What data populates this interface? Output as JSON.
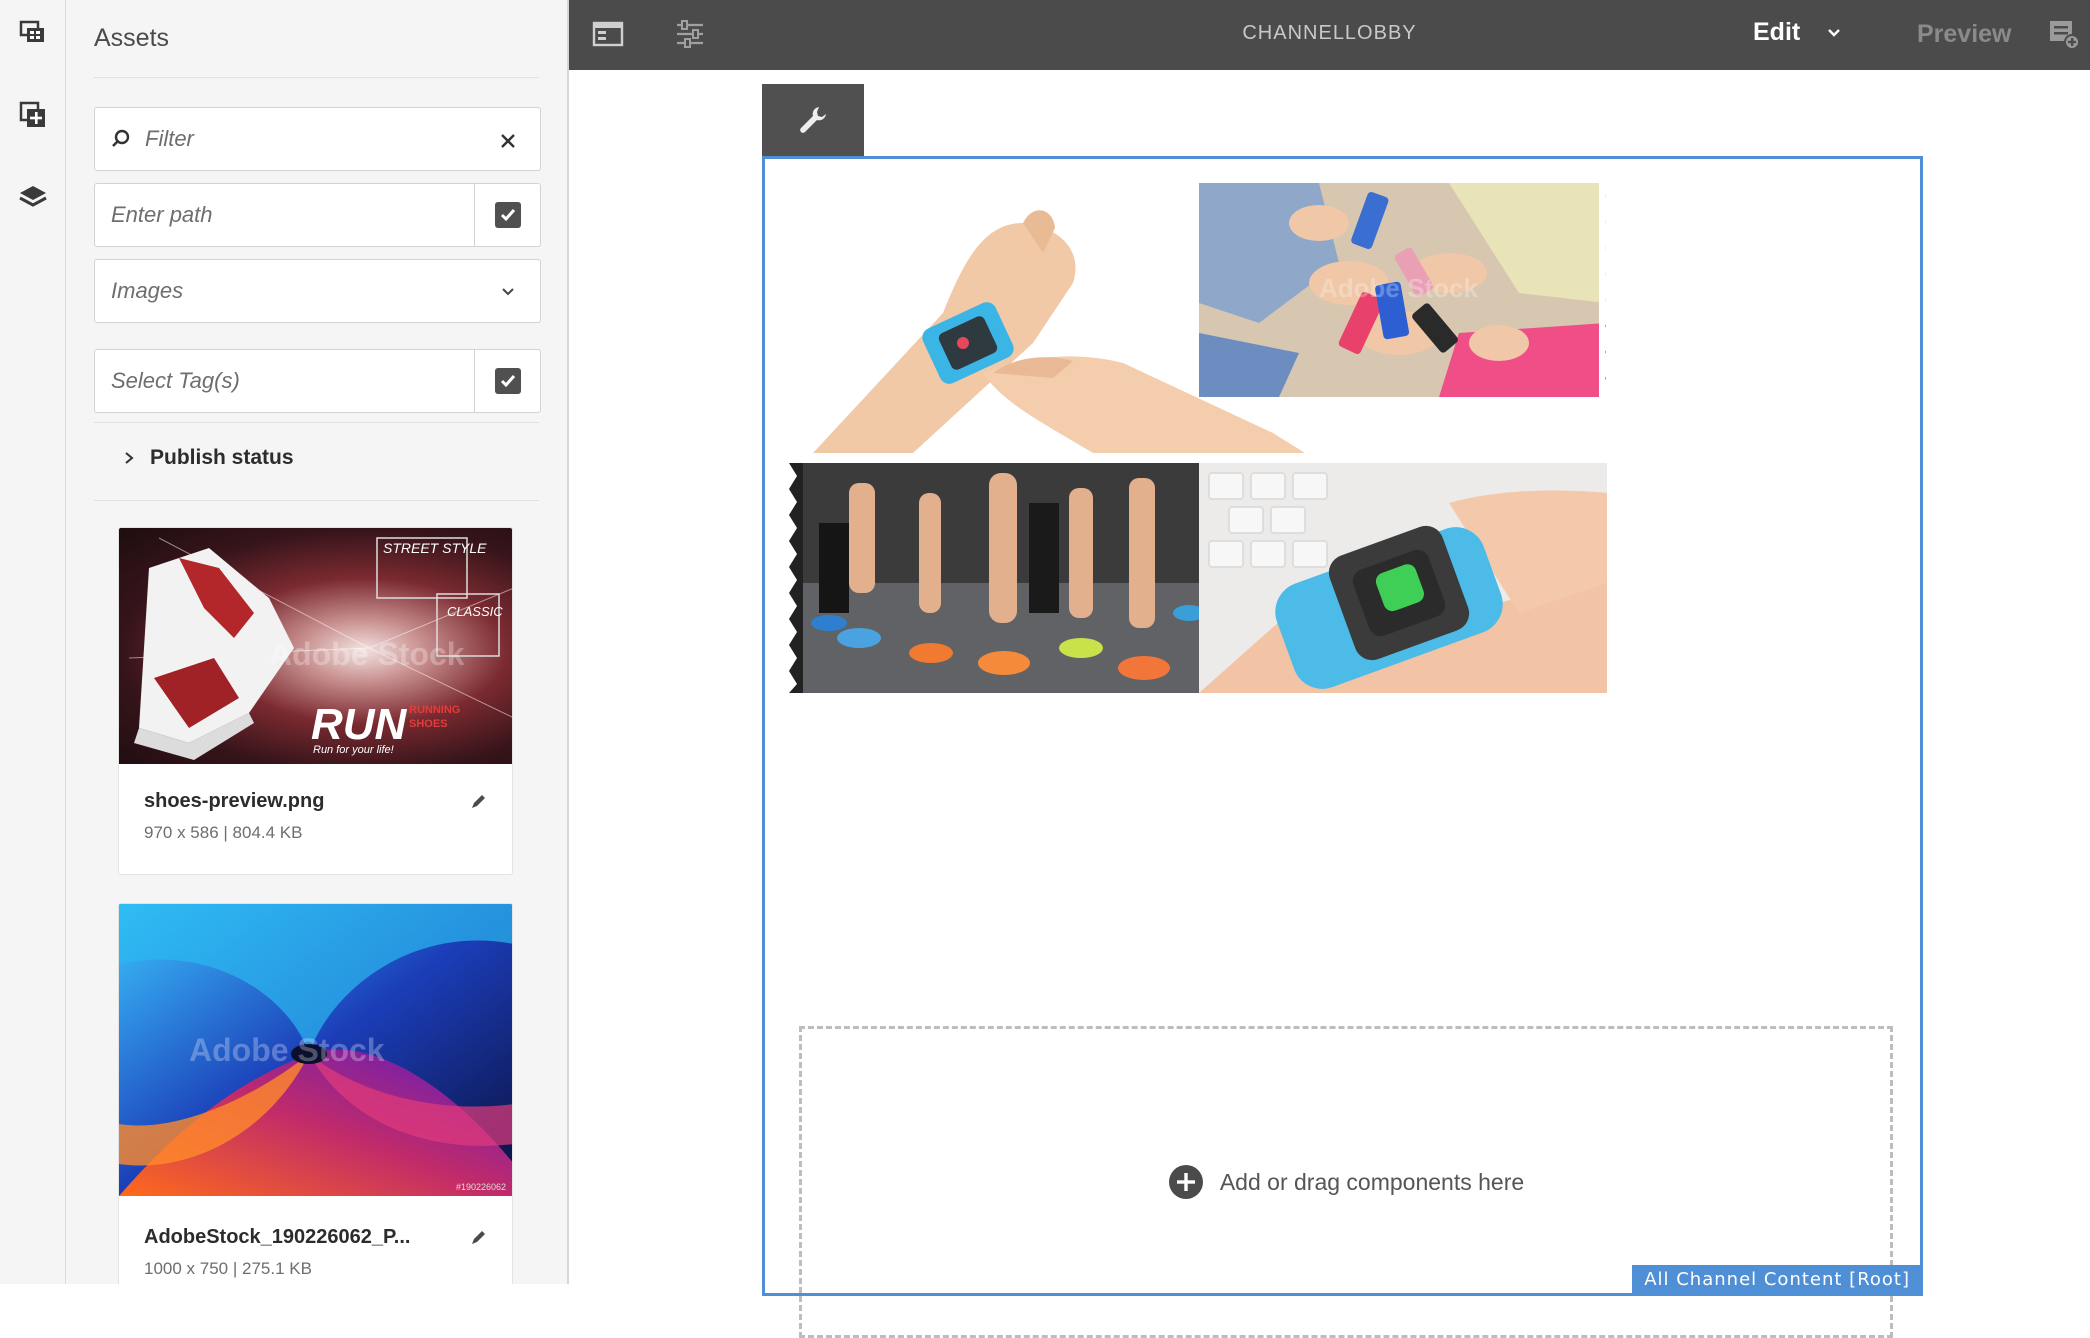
{
  "rail": {
    "icons": [
      "assets-icon",
      "components-icon",
      "layers-icon"
    ]
  },
  "panel": {
    "title": "Assets",
    "filter_placeholder": "Filter",
    "path_placeholder": "Enter path",
    "type_select": "Images",
    "tags_placeholder": "Select Tag(s)",
    "publish_status": "Publish status",
    "assets": [
      {
        "name": "shoes-preview.png",
        "info": "970 x 586 | 804.4 KB",
        "text_headline": "RUN",
        "text_tag1": "STREET STYLE",
        "text_tag2": "CLASSIC",
        "text_sub1": "RUNNING",
        "text_sub2": "SHOES",
        "text_slogan": "Run for your life!",
        "watermark": "Adobe Stock"
      },
      {
        "name": "AdobeStock_190226062_P...",
        "info": "1000 x 750 | 275.1 KB",
        "watermark": "Adobe Stock",
        "stock_id": "#190226062"
      }
    ]
  },
  "toolbar": {
    "title": "CHANNELLOBBY",
    "mode": "Edit",
    "preview": "Preview"
  },
  "canvas": {
    "placeholder_text": "Add or drag components here",
    "root_label": "All Channel Content [Root]",
    "watermark": "Adobe Stock"
  },
  "colors": {
    "toolbar_bg": "#4b4b4b",
    "selection_blue": "#4f8fd6",
    "panel_bg": "#f5f5f5"
  }
}
